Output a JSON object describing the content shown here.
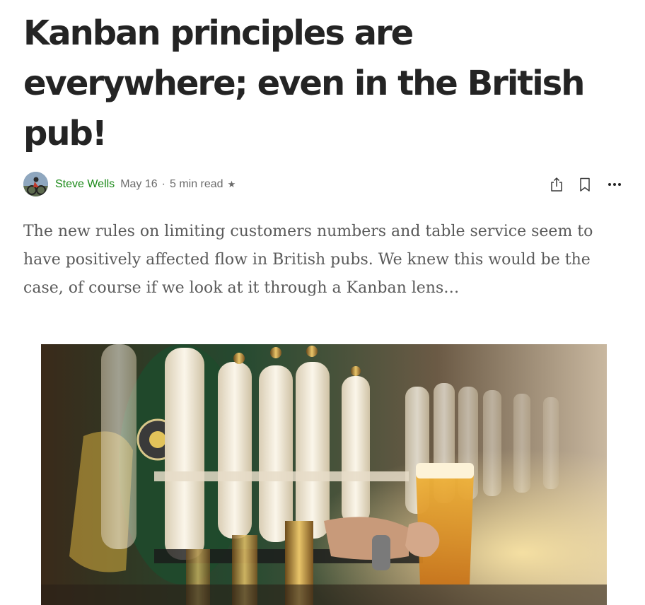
{
  "article": {
    "title": "Kanban principles are everywhere; even in the British pub!",
    "subtitle": "The new rules on limiting customers numbers and table service seem to have positively affected flow in British pubs. We knew this would be the case, of course if we look at it through a Kanban lens…"
  },
  "author": {
    "name": "Steve Wells",
    "date": "May 16",
    "separator": "·",
    "read_time": "5 min read",
    "member_star": "★"
  },
  "actions": {
    "share_icon": "share-icon",
    "bookmark_icon": "bookmark-icon",
    "more_icon": "more-horizontal-icon"
  },
  "colors": {
    "author_link": "#1a8917",
    "title_text": "#242424",
    "body_text": "#5a5a5a",
    "meta_text": "#6b6b6b"
  }
}
